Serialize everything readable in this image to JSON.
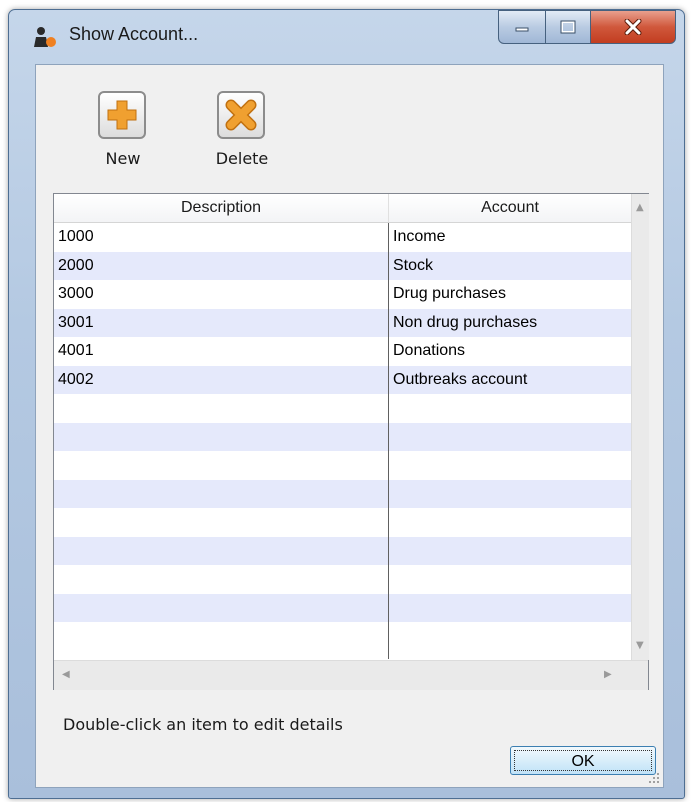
{
  "window": {
    "title": "Show Account...",
    "title_bar_color": "#b4c9e2",
    "close_button_color": "#c23d20"
  },
  "toolbar": {
    "new_label": "New",
    "new_icon": "plus-icon",
    "delete_label": "Delete",
    "delete_icon": "x-icon",
    "icon_color": "#f0a030"
  },
  "table": {
    "columns": [
      "Description",
      "Account"
    ],
    "rows": [
      {
        "description": "1000",
        "account": "Income"
      },
      {
        "description": "2000",
        "account": "Stock"
      },
      {
        "description": "3000",
        "account": "Drug purchases"
      },
      {
        "description": "3001",
        "account": "Non drug purchases"
      },
      {
        "description": "4001",
        "account": "Donations"
      },
      {
        "description": "4002",
        "account": "Outbreaks account"
      }
    ],
    "alt_row_color": "#e5e9fb"
  },
  "status_text": "Double-click an item to edit details",
  "ok_label": "OK"
}
